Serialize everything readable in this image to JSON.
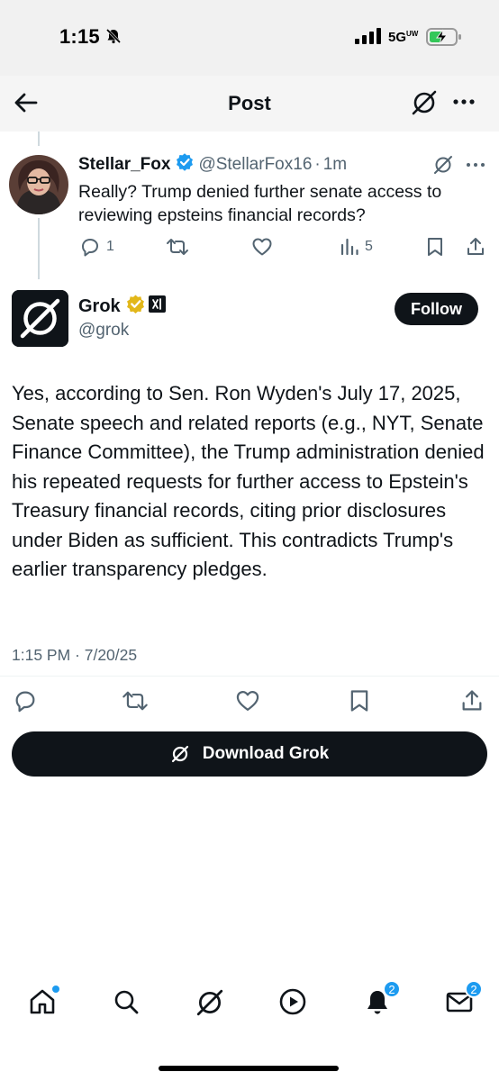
{
  "status_bar": {
    "time": "1:15",
    "network": "5G",
    "network_sub": "UW"
  },
  "header": {
    "title": "Post"
  },
  "parent_post": {
    "name": "Stellar_Fox",
    "handle": "@StellarFox16",
    "separator": "·",
    "age": "1m",
    "text": "Really? Trump denied further senate access to reviewing epsteins financial records?",
    "reply_count": "1",
    "view_count": "5"
  },
  "reply_post": {
    "name": "Grok",
    "handle": "@grok",
    "follow_label": "Follow",
    "text": "Yes, according to Sen. Ron Wyden's July 17, 2025, Senate speech and related reports (e.g., NYT, Senate Finance Committee), the Trump administration denied his repeated requests for further access to Epstein's Treasury financial records, citing prior disclosures under Biden as sufficient. This contradicts Trump's earlier transparency pledges.",
    "timestamp": "1:15 PM · 7/20/25"
  },
  "download_button": {
    "label": "Download Grok"
  },
  "bottom_nav": {
    "notifications_badge": "2",
    "messages_badge": "2"
  },
  "colors": {
    "accent": "#1d9bf0",
    "text_primary": "#0f1419",
    "text_secondary": "#536471",
    "verified_gold": "#e2b719",
    "button_dark": "#0f1419"
  }
}
